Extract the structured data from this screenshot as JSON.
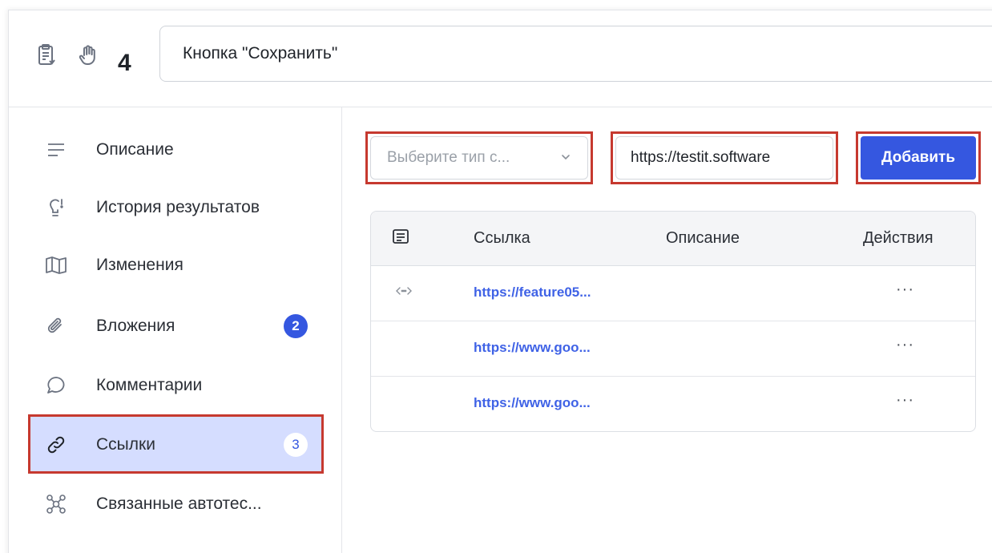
{
  "header": {
    "number": "4",
    "title": "Кнопка \"Сохранить\""
  },
  "sidebar": {
    "items": [
      {
        "label": "Описание",
        "icon": "menu-lines-icon"
      },
      {
        "label": "История результатов",
        "icon": "lightbulb-icon"
      },
      {
        "label": "Изменения",
        "icon": "map-icon"
      },
      {
        "label": "Вложения",
        "icon": "paperclip-icon",
        "badge": "2"
      },
      {
        "label": "Комментарии",
        "icon": "comment-icon"
      },
      {
        "label": "Ссылки",
        "icon": "link-icon",
        "badge": "3",
        "active": true
      },
      {
        "label": "Связанные автотес...",
        "icon": "graph-nodes-icon"
      }
    ]
  },
  "toolbar": {
    "type_placeholder": "Выберите тип с...",
    "url_value": "https://testit.software",
    "add_label": "Добавить"
  },
  "table": {
    "columns": [
      "Ссылка",
      "Описание",
      "Действия"
    ],
    "rows": [
      {
        "link": "https://feature05...",
        "description": "",
        "actions": "···",
        "icon": "code-icon"
      },
      {
        "link": "https://www.goo...",
        "description": "",
        "actions": "···"
      },
      {
        "link": "https://www.goo...",
        "description": "",
        "actions": "···"
      }
    ]
  },
  "colors": {
    "accent": "#3557e0",
    "active_bg": "#d5ddff",
    "highlight": "#c6392f",
    "link": "#3f62e6"
  }
}
